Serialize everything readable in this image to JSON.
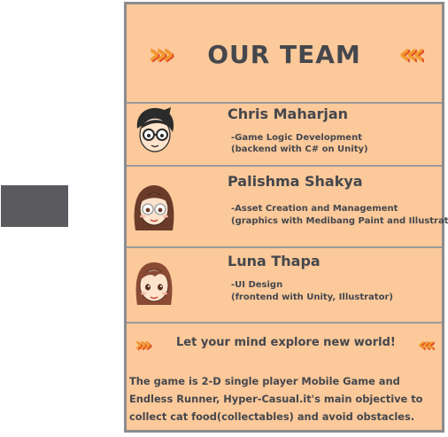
{
  "header": {
    "title": "OUR TEAM"
  },
  "members": [
    {
      "name": "Chris Maharjan",
      "role": "-Game Logic Development",
      "detail": "(backend with C# on Unity)"
    },
    {
      "name": "Palishma Shakya",
      "role": "-Asset Creation and Management",
      "detail": "(graphics with Medibang Paint and Illustrator)"
    },
    {
      "name": "Luna Thapa",
      "role": "-UI Design",
      "detail": "(frontend with Unity, Illustrator)"
    }
  ],
  "footer": {
    "tagline": "Let your mind explore new world!",
    "description": "The  game is 2-D single player Mobile Game and Endless Runner, Hyper-Casual.it's main objective to collect cat food(collectables) and avoid obstacles."
  },
  "colors": {
    "panel_bg": "#fbc99a",
    "border": "#8c8c8e",
    "text": "#45474d",
    "chevron": "#f29b2b",
    "chevron_shadow": "#e0492a"
  },
  "icons": [
    "chevrons-right-icon",
    "chevrons-left-icon",
    "avatar-glasses-icon",
    "avatar-long-hair-icon",
    "avatar-bangs-icon"
  ]
}
